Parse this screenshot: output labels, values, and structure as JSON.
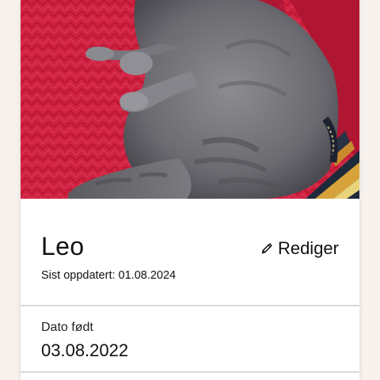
{
  "pet": {
    "name": "Leo",
    "updated_label": "Sist oppdatert:",
    "updated_date": "01.08.2024"
  },
  "actions": {
    "edit_label": "Rediger",
    "edit_icon": "pencil-icon"
  },
  "fields": {
    "birth": {
      "label": "Dato født",
      "value": "03.08.2022"
    }
  },
  "photo": {
    "subject": "grey-cat-photo"
  },
  "colors": {
    "background": "#f7f2ee",
    "card": "#ffffff",
    "divider": "#d9d9d9",
    "text": "#111111"
  }
}
